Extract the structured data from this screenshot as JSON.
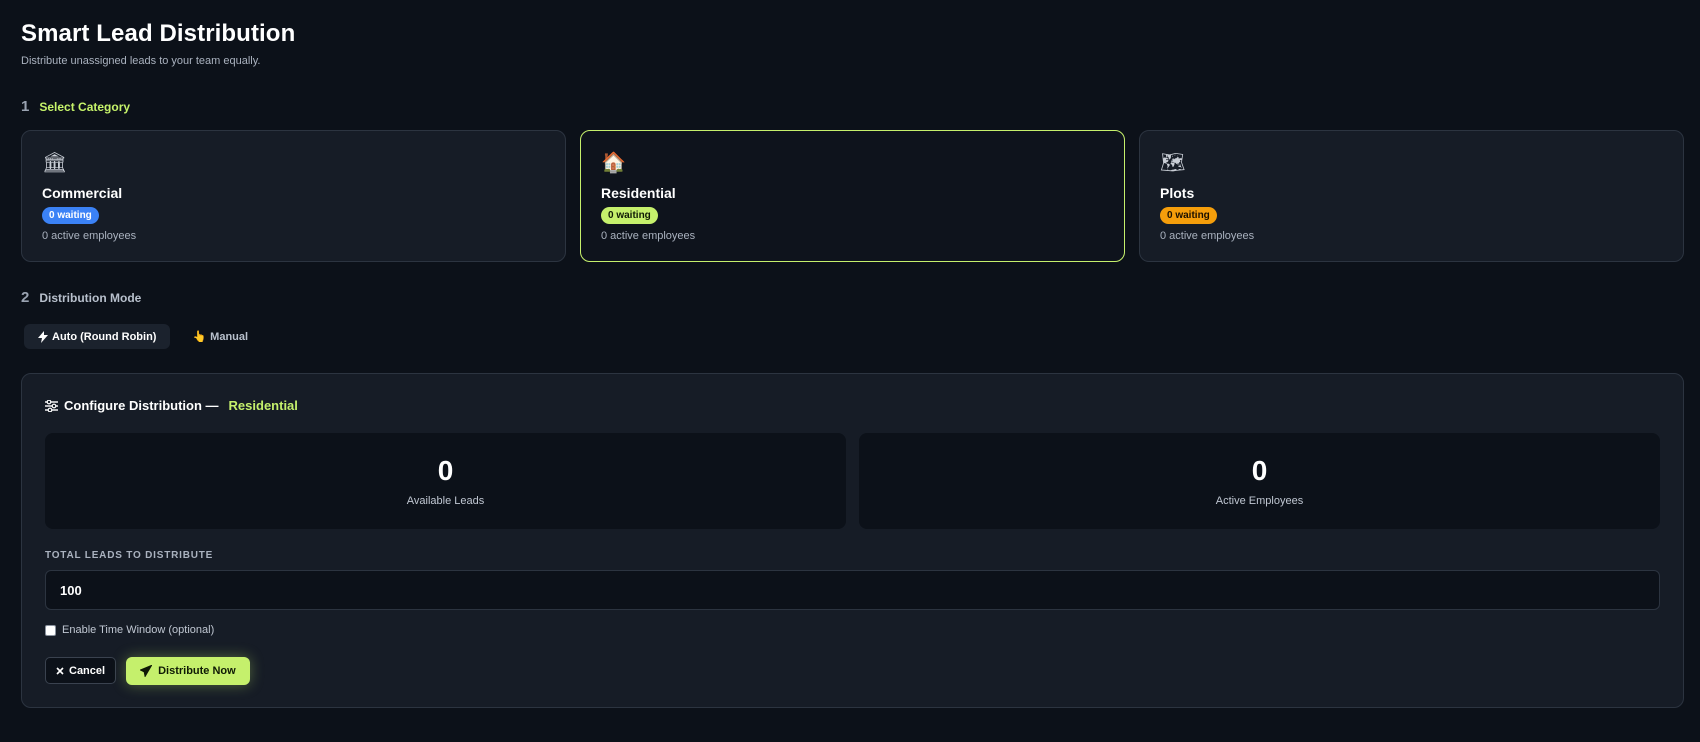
{
  "header": {
    "title": "Smart Lead Distribution",
    "subtitle": "Distribute unassigned leads to your team equally."
  },
  "step1": {
    "number": "1",
    "label": "Select Category"
  },
  "categories": [
    {
      "name": "Commercial",
      "icon": "bank-building-icon",
      "waiting": "0 waiting",
      "employees": "0 active employees",
      "badge_color": "#3b82f6",
      "selected": false
    },
    {
      "name": "Residential",
      "icon": "house-icon",
      "waiting": "0 waiting",
      "employees": "0 active employees",
      "badge_color": "#c5f06c",
      "selected": true
    },
    {
      "name": "Plots",
      "icon": "map-icon",
      "waiting": "0 waiting",
      "employees": "0 active employees",
      "badge_color": "#f59e0b",
      "selected": false
    }
  ],
  "step2": {
    "number": "2",
    "label": "Distribution Mode"
  },
  "modes": {
    "auto": "Auto (Round Robin)",
    "manual": "Manual",
    "active": "auto"
  },
  "config": {
    "title": "Configure Distribution —",
    "category": "Residential",
    "stats": [
      {
        "value": "0",
        "label": "Available Leads"
      },
      {
        "value": "0",
        "label": "Active Employees"
      }
    ],
    "total_label": "TOTAL LEADS TO DISTRIBUTE",
    "total_value": "100",
    "time_window_label": "Enable Time Window (optional)",
    "time_window_checked": false,
    "cancel_label": "Cancel",
    "submit_label": "Distribute Now"
  },
  "colors": {
    "accent": "#c5f06c",
    "background": "#0c1119",
    "panel": "#161c26"
  }
}
